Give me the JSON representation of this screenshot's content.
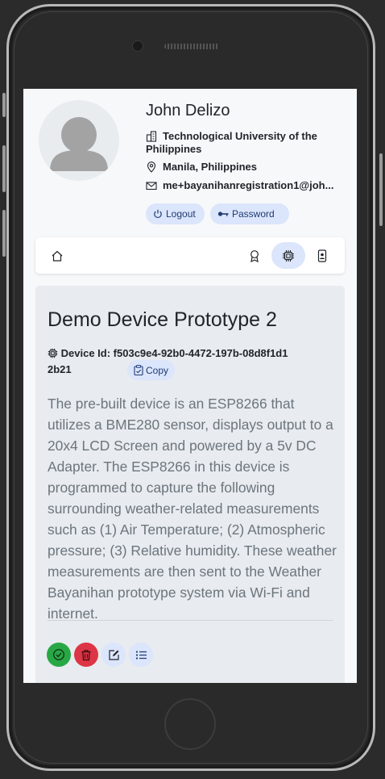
{
  "profile": {
    "name": "John Delizo",
    "university": "Technological University of the Philippines",
    "location": "Manila, Philippines",
    "email": "me+bayanihanregistration1@joh...",
    "logout_label": "Logout",
    "password_label": "Password"
  },
  "nav": {
    "items": [
      "home-icon",
      "award-icon",
      "cpu-icon",
      "phone-badge-icon"
    ],
    "active": "cpu-icon"
  },
  "device": {
    "title": "Demo Device Prototype 2",
    "id_label": "Device Id:",
    "id_value": "f503c9e4-92b0-4472-197b-08d8f1d12b21",
    "copy_label": "Copy",
    "description": "The pre-built device is an ESP8266 that utilizes a BME280 sensor, displays output to a 20x4 LCD Screen and powered by a 5v DC Adapter. The ESP8266 in this device is programmed to capture the following surrounding weather-related measurements such as (1) Air Temperature; (2) Atmospheric pressure; (3) Relative humidity. These weather measurements are then sent to the Weather Bayanihan prototype system via Wi-Fi and internet."
  },
  "actions": [
    "check-circle-icon",
    "trash-icon",
    "edit-icon",
    "list-icon"
  ],
  "colors": {
    "accent_pill": "#dbe5fb",
    "success": "#28a745",
    "danger": "#dc3545",
    "card_bg": "#e8ebef"
  }
}
